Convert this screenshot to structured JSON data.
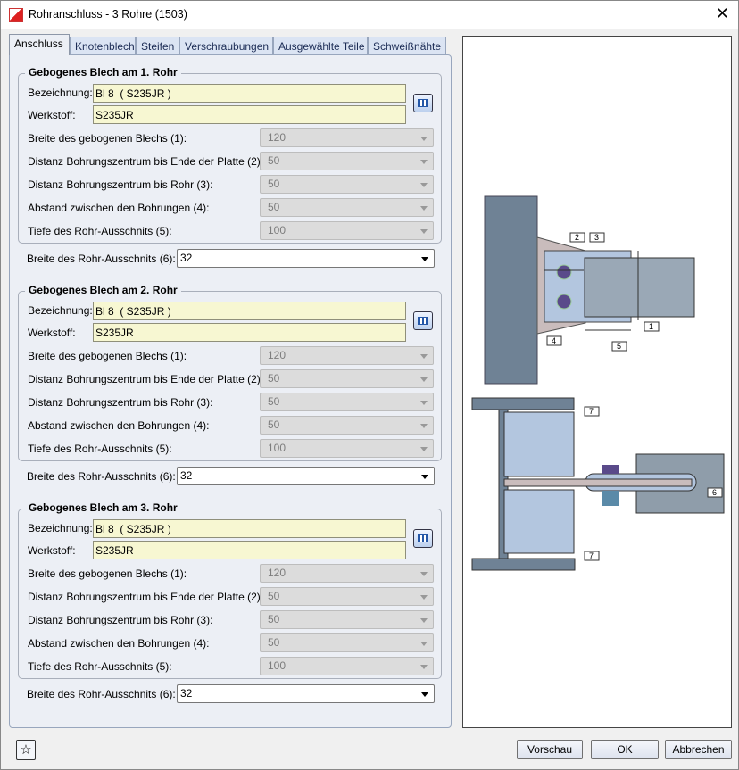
{
  "window": {
    "title": "Rohranschluss - 3 Rohre (1503)"
  },
  "tabs": [
    {
      "label": "Anschluss",
      "active": true
    },
    {
      "label": "Knotenblech"
    },
    {
      "label": "Steifen"
    },
    {
      "label": "Verschraubungen"
    },
    {
      "label": "Ausgewählte Teile"
    },
    {
      "label": "Schweißnähte"
    }
  ],
  "groups": [
    {
      "title": "Gebogenes Blech am 1. Rohr",
      "bezeichnung_label": "Bezeichnung:",
      "bezeichnung": "Bl 8  ( S235JR )",
      "werkstoff_label": "Werkstoff:",
      "werkstoff": "S235JR",
      "fields": [
        {
          "label": "Breite des gebogenen Blechs (1):",
          "value": "120"
        },
        {
          "label": "Distanz Bohrungszentrum bis Ende der Platte (2):",
          "value": "50"
        },
        {
          "label": "Distanz Bohrungszentrum bis Rohr (3):",
          "value": "50"
        },
        {
          "label": "Abstand zwischen den Bohrungen (4):",
          "value": "50"
        },
        {
          "label": "Tiefe des Rohr-Ausschnits (5):",
          "value": "100"
        }
      ],
      "cutout_label": "Breite des Rohr-Ausschnits (6):",
      "cutout_value": "32"
    },
    {
      "title": "Gebogenes Blech am 2. Rohr",
      "bezeichnung_label": "Bezeichnung:",
      "bezeichnung": "Bl 8  ( S235JR )",
      "werkstoff_label": "Werkstoff:",
      "werkstoff": "S235JR",
      "fields": [
        {
          "label": "Breite des gebogenen Blechs (1):",
          "value": "120"
        },
        {
          "label": "Distanz Bohrungszentrum bis Ende der Platte (2):",
          "value": "50"
        },
        {
          "label": "Distanz Bohrungszentrum bis Rohr (3):",
          "value": "50"
        },
        {
          "label": "Abstand zwischen den Bohrungen (4):",
          "value": "50"
        },
        {
          "label": "Tiefe des Rohr-Ausschnits (5):",
          "value": "100"
        }
      ],
      "cutout_label": "Breite des Rohr-Ausschnits (6):",
      "cutout_value": "32"
    },
    {
      "title": "Gebogenes Blech am 3. Rohr",
      "bezeichnung_label": "Bezeichnung:",
      "bezeichnung": "Bl 8  ( S235JR )",
      "werkstoff_label": "Werkstoff:",
      "werkstoff": "S235JR",
      "fields": [
        {
          "label": "Breite des gebogenen Blechs (1):",
          "value": "120"
        },
        {
          "label": "Distanz Bohrungszentrum bis Ende der Platte (2):",
          "value": "50"
        },
        {
          "label": "Distanz Bohrungszentrum bis Rohr (3):",
          "value": "50"
        },
        {
          "label": "Abstand zwischen den Bohrungen (4):",
          "value": "50"
        },
        {
          "label": "Tiefe des Rohr-Ausschnits (5):",
          "value": "100"
        }
      ],
      "cutout_label": "Breite des Rohr-Ausschnits (6):",
      "cutout_value": "32"
    }
  ],
  "preview": {
    "callouts": [
      "1",
      "2",
      "3",
      "4",
      "5",
      "6",
      "7",
      "7"
    ]
  },
  "buttons": {
    "preview": "Vorschau",
    "ok": "OK",
    "cancel": "Abbrechen"
  },
  "icons": {
    "favorite": "star-icon",
    "library": "catalog-icon",
    "close": "close-icon"
  }
}
